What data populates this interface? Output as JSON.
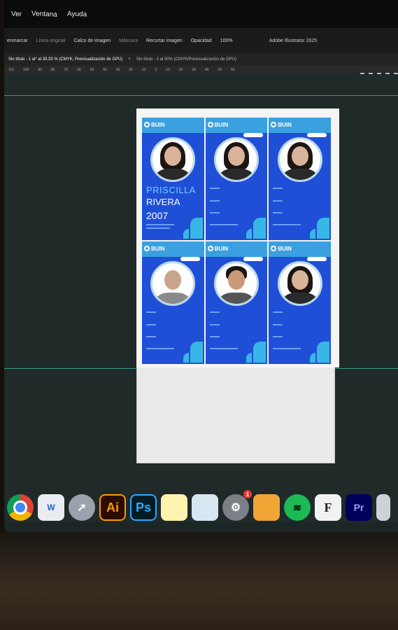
{
  "menu": {
    "items": [
      "Ver",
      "Ventana",
      "Ayuda"
    ]
  },
  "options": {
    "left": "enmarcar",
    "original": "Línea original",
    "crop": "Calco de imagen",
    "mask": "Máscara",
    "recolor": "Recortar imagen",
    "opacity_label": "Opacidad",
    "opacity_value": "100%",
    "app_title": "Adobe Illustrator 2025"
  },
  "tabs": [
    "Sin título - 1 ai* al 33,33 % (CMYK, Previsualización de GPU)",
    "Sin título - 2 al 50% (CMYK/Previsualización de GPU)"
  ],
  "ruler": [
    "110",
    "100",
    "90",
    "80",
    "70",
    "60",
    "50",
    "40",
    "30",
    "20",
    "10",
    "0",
    "10",
    "20",
    "30",
    "40",
    "50",
    "60"
  ],
  "card": {
    "brand": "BUIN",
    "first_name": "PRISCILLA",
    "last_name": "RIVERA",
    "year": "2007"
  },
  "dock": {
    "apps": [
      "Chrome",
      "Word",
      "Launchpad",
      "Illustrator",
      "Photoshop",
      "Notes",
      "Preview",
      "Settings",
      "Archive",
      "Spotify",
      "Font Book",
      "Premiere Pro",
      "USB"
    ],
    "ai_label": "Ai",
    "ps_label": "Ps",
    "pr_label": "Pr",
    "font_label": "F",
    "word_label": "W",
    "settings_badge": "1"
  }
}
